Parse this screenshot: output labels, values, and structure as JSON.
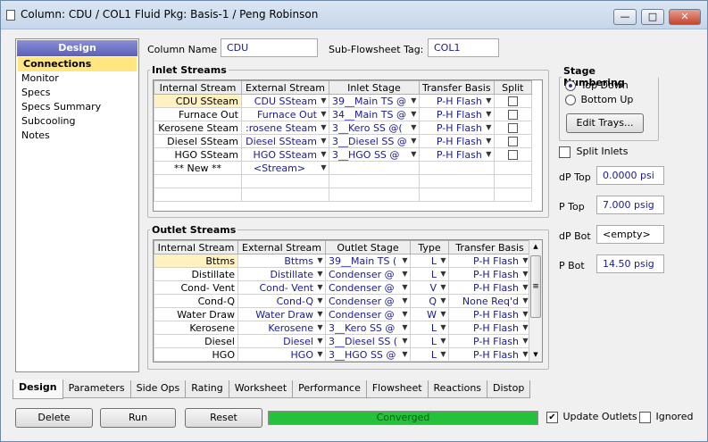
{
  "window": {
    "title": "Column: CDU / COL1  Fluid Pkg: Basis-1 / Peng Robinson",
    "minimize_glyph": "—",
    "maximize_glyph": "□",
    "close_glyph": "✕"
  },
  "nav": {
    "header": "Design",
    "items": [
      "Connections",
      "Monitor",
      "Specs",
      "Specs Summary",
      "Subcooling",
      "Notes"
    ]
  },
  "column_name": {
    "label": "Column Name",
    "value": "CDU"
  },
  "subflowsheet": {
    "label": "Sub-Flowsheet Tag:",
    "value": "COL1"
  },
  "inlet": {
    "legend": "Inlet Streams",
    "headers": [
      "Internal Stream",
      "External Stream",
      "Inlet Stage",
      "Transfer Basis",
      "Split"
    ],
    "rows": [
      {
        "internal": "CDU SSteam",
        "external": "CDU SSteam",
        "stage": "39__Main TS @",
        "basis": "P-H Flash"
      },
      {
        "internal": "Furnace Out",
        "external": "Furnace Out",
        "stage": "34__Main TS @",
        "basis": "P-H Flash"
      },
      {
        "internal": "Kerosene Steam",
        "external": ":rosene Steam",
        "stage": "3__Kero SS @(",
        "basis": "P-H Flash"
      },
      {
        "internal": "Diesel SSteam",
        "external": "Diesel SSteam",
        "stage": "3__Diesel SS @",
        "basis": "P-H Flash"
      },
      {
        "internal": "HGO SSteam",
        "external": "HGO SSteam",
        "stage": "3__HGO SS @",
        "basis": "P-H Flash"
      }
    ],
    "new_row": {
      "internal": "** New **",
      "external": "<Stream>"
    }
  },
  "outlet": {
    "legend": "Outlet Streams",
    "headers": [
      "Internal Stream",
      "External Stream",
      "Outlet Stage",
      "Type",
      "Transfer Basis"
    ],
    "rows": [
      {
        "internal": "Bttms",
        "external": "Bttms",
        "stage": "39__Main TS (",
        "type": "L",
        "basis": "P-H Flash"
      },
      {
        "internal": "Distillate",
        "external": "Distillate",
        "stage": "Condenser @",
        "type": "L",
        "basis": "P-H Flash"
      },
      {
        "internal": "Cond- Vent",
        "external": "Cond- Vent",
        "stage": "Condenser @",
        "type": "V",
        "basis": "P-H Flash"
      },
      {
        "internal": "Cond-Q",
        "external": "Cond-Q",
        "stage": "Condenser @",
        "type": "Q",
        "basis": "None Req'd"
      },
      {
        "internal": "Water Draw",
        "external": "Water Draw",
        "stage": "Condenser @",
        "type": "W",
        "basis": "P-H Flash"
      },
      {
        "internal": "Kerosene",
        "external": "Kerosene",
        "stage": "3__Kero SS @",
        "type": "L",
        "basis": "P-H Flash"
      },
      {
        "internal": "Diesel",
        "external": "Diesel",
        "stage": "3__Diesel SS (",
        "type": "L",
        "basis": "P-H Flash"
      },
      {
        "internal": "HGO",
        "external": "HGO",
        "stage": "3__HGO SS @",
        "type": "L",
        "basis": "P-H Flash"
      }
    ]
  },
  "stage_numbering": {
    "legend": "Stage Numbering",
    "top_down": "Top Down",
    "bottom_up": "Bottom Up",
    "edit_trays": "Edit Trays..."
  },
  "split_inlets": "Split Inlets",
  "pressures": {
    "dp_top": {
      "label": "dP Top",
      "value": "0.0000 psi"
    },
    "p_top": {
      "label": "P Top",
      "value": "7.000 psig"
    },
    "dp_bot": {
      "label": "dP Bot",
      "value": "<empty>"
    },
    "p_bot": {
      "label": "P Bot",
      "value": "14.50 psig"
    }
  },
  "tabs": [
    "Design",
    "Parameters",
    "Side Ops",
    "Rating",
    "Worksheet",
    "Performance",
    "Flowsheet",
    "Reactions",
    "Distop"
  ],
  "footer": {
    "delete": "Delete",
    "run": "Run",
    "reset": "Reset",
    "status": "Converged",
    "update_outlets": "Update Outlets",
    "ignored": "Ignored",
    "check_glyph": "✔"
  },
  "glyphs": {
    "dropdown": "▼",
    "scroll_up": "▲",
    "scroll_down": "▼",
    "thumb_grip": "≡"
  },
  "colors": {
    "status_green": "#23c23a",
    "nav_header": "#5b60b8",
    "selected": "#ffe680",
    "value_text": "#1a1a8c"
  }
}
